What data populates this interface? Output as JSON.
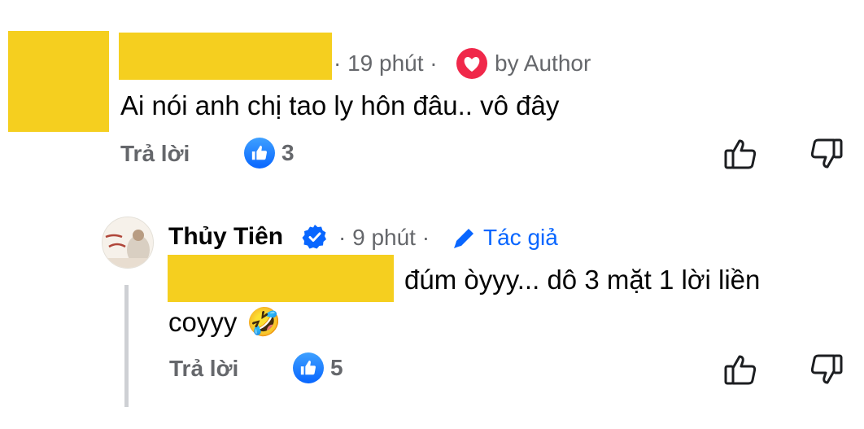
{
  "comment1": {
    "time": "· 19 phút ·",
    "author_badge": "by Author",
    "text": "Ai nói anh chị tao ly hôn đâu.. vô đây",
    "reply_label": "Trả lời",
    "like_count": "3",
    "heart_color": "#f0284a"
  },
  "comment2": {
    "name": "Thủy Tiên",
    "time": "· 9 phút ·",
    "author_tag": "Tác giả",
    "text_line1": "đúm òyyy... dô 3 mặt 1 lời liền",
    "text_line2": "coyyy",
    "emoji": "🤣",
    "reply_label": "Trả lời",
    "like_count": "5",
    "verified_color": "#0866ff"
  },
  "colors": {
    "redaction": "#f5cf1f",
    "accent": "#0866ff",
    "muted": "#65676b"
  }
}
